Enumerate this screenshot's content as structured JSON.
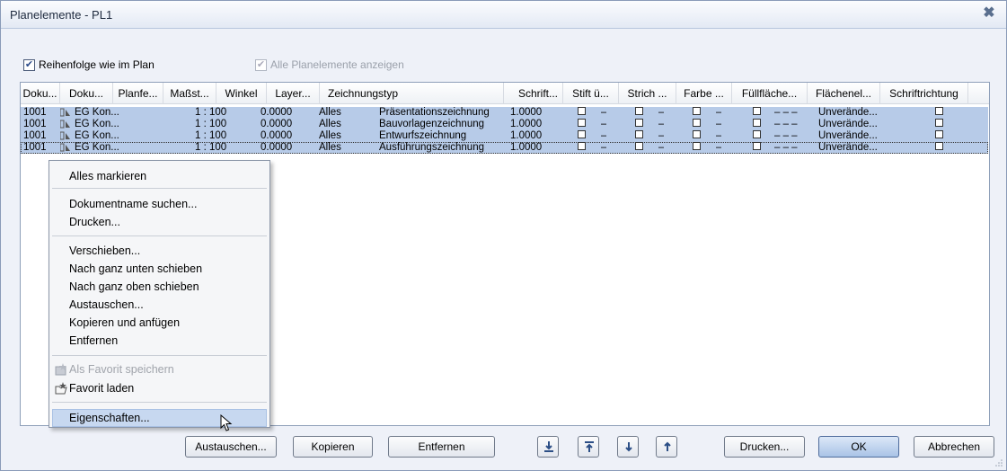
{
  "window": {
    "title": "Planelemente - PL1"
  },
  "options": {
    "order_label": "Reihenfolge wie im Plan",
    "order_checked": true,
    "show_all_label": "Alle Planelemente anzeigen",
    "show_all_checked": true
  },
  "grid": {
    "columns": [
      "Doku...",
      "Doku...",
      "Planfe...",
      "Maßst...",
      "Winkel",
      "Layer...",
      "Zeichnungstyp",
      "Schrift...",
      "Stift ü...",
      "Strich ...",
      "Farbe ...",
      "Füllfläche...",
      "Flächenel...",
      "Schriftrichtung"
    ],
    "rows": [
      {
        "nr": "1001",
        "name": "EG Kon...",
        "scale": "1 : 100",
        "angle": "0.0000",
        "layer": "Alles",
        "type": "Präsentationszeichnung",
        "font": "1.0000",
        "dash": "–",
        "dash2": "–",
        "dash3": "–",
        "fill": "– – –",
        "area": "Unverände..."
      },
      {
        "nr": "1001",
        "name": "EG Kon...",
        "scale": "1 : 100",
        "angle": "0.0000",
        "layer": "Alles",
        "type": "Bauvorlagenzeichnung",
        "font": "1.0000",
        "dash": "–",
        "dash2": "–",
        "dash3": "–",
        "fill": "– – –",
        "area": "Unverände..."
      },
      {
        "nr": "1001",
        "name": "EG Kon...",
        "scale": "1 : 100",
        "angle": "0.0000",
        "layer": "Alles",
        "type": "Entwurfszeichnung",
        "font": "1.0000",
        "dash": "–",
        "dash2": "–",
        "dash3": "–",
        "fill": "– – –",
        "area": "Unverände..."
      },
      {
        "nr": "1001",
        "name": "EG Kon...",
        "scale": "1 : 100",
        "angle": "0.0000",
        "layer": "Alles",
        "type": "Ausführungszeichnung",
        "font": "1.0000",
        "dash": "–",
        "dash2": "–",
        "dash3": "–",
        "fill": "– – –",
        "area": "Unverände..."
      }
    ]
  },
  "context_menu": {
    "items": [
      {
        "label": "Alles markieren",
        "u": "A"
      },
      {
        "label": "Dokumentname suchen...",
        "u": "D"
      },
      {
        "label": "Drucken...",
        "u": "D"
      },
      {
        "label": "Verschieben...",
        "u": "V"
      },
      {
        "label": "Nach ganz unten schieben"
      },
      {
        "label": "Nach ganz oben schieben"
      },
      {
        "label": "Austauschen...",
        "u": "s"
      },
      {
        "label": "Kopieren und anfügen"
      },
      {
        "label": "Entfernen",
        "u": "E"
      },
      {
        "label": "Als Favorit speichern",
        "disabled": true,
        "icon": "save-favorite-icon"
      },
      {
        "label": "Favorit laden",
        "icon": "load-favorite-icon"
      },
      {
        "label": "Eigenschaften...",
        "u": "i",
        "highlighted": true
      }
    ]
  },
  "buttons": {
    "austauschen": "Austauschen...",
    "kopieren": "Kopieren",
    "entfernen": "Entfernen",
    "drucken": "Drucken...",
    "ok": "OK",
    "abbrechen": "Abbrechen"
  },
  "icons": {
    "move_bottom": "move-to-bottom-icon",
    "move_top": "move-to-top-icon",
    "move_down": "move-down-icon",
    "move_up": "move-up-icon"
  },
  "colors": {
    "selection": "#b7cbe8",
    "window_bg": "#eef1f8",
    "menu_highlight": "#c7d8f0"
  }
}
